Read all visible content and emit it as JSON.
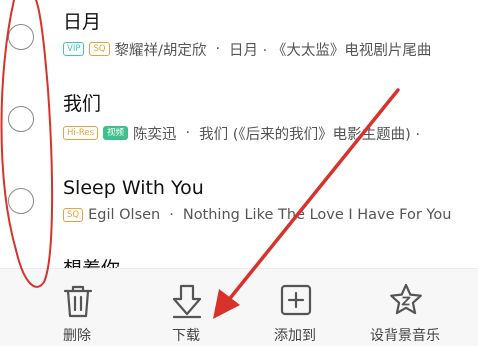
{
  "songs": [
    {
      "title": "日月",
      "tags": [
        "VIP",
        "SQ"
      ],
      "artist": "黎耀祥/胡定欣",
      "sep": "·",
      "album": "日月 · 《大太监》电视剧片尾曲"
    },
    {
      "title": "我们",
      "tags": [
        "Hi-Res",
        "视频"
      ],
      "artist": "陈奕迅",
      "sep": "·",
      "album": "我们 (《后来的我们》电影主题曲) ·"
    },
    {
      "title": "Sleep With You",
      "tags": [
        "SQ"
      ],
      "artist": "Egil Olsen",
      "sep": "·",
      "album": "Nothing Like The Love I Have For You"
    }
  ],
  "partial_title": "想着你",
  "toolbar": {
    "delete_label": "删除",
    "download_label": "下载",
    "add_to_label": "添加到",
    "set_bg_music_label": "设背景音乐"
  },
  "icons": {
    "delete": "trash-icon",
    "download": "download-arrow-icon",
    "add_to": "plus-square-icon",
    "set_bg_music": "star-z-icon"
  },
  "colors": {
    "annotation_red": "#d8322a",
    "vip_tag": "#3ec6b4",
    "sq_tag": "#e6a23c",
    "mv_tag": "#3ec08a",
    "icon_gray": "#555555"
  }
}
